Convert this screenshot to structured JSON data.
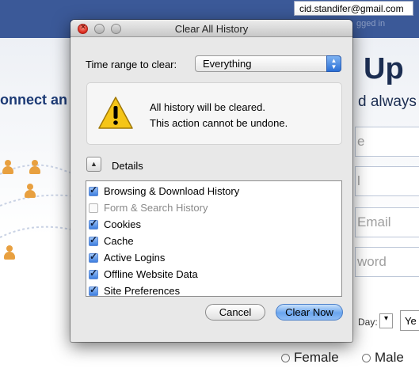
{
  "background": {
    "email_field": "cid.standifer@gmail.com",
    "logged_in_text": "gged in",
    "connect_text": "onnect an",
    "signup_heading": "Up",
    "always_text": "d always",
    "reg_fields": [
      {
        "placeholder": "e"
      },
      {
        "placeholder": "l"
      },
      {
        "placeholder": "Email"
      },
      {
        "placeholder": "word"
      }
    ],
    "birthday_label": "Day:",
    "day_select": "▾",
    "year_select": "Ye",
    "gender_female": "Female",
    "gender_male": "Male"
  },
  "dialog": {
    "title": "Clear All History",
    "time_range_label": "Time range to clear:",
    "time_range_value": "Everything",
    "warning_line1": "All history will be cleared.",
    "warning_line2": "This action cannot be undone.",
    "details_label": "Details",
    "items": [
      {
        "label": "Browsing & Download History",
        "checked": true,
        "enabled": true
      },
      {
        "label": "Form & Search History",
        "checked": false,
        "enabled": false
      },
      {
        "label": "Cookies",
        "checked": true,
        "enabled": true
      },
      {
        "label": "Cache",
        "checked": true,
        "enabled": true
      },
      {
        "label": "Active Logins",
        "checked": true,
        "enabled": true
      },
      {
        "label": "Offline Website Data",
        "checked": true,
        "enabled": true
      },
      {
        "label": "Site Preferences",
        "checked": true,
        "enabled": true
      }
    ],
    "cancel_label": "Cancel",
    "clear_label": "Clear Now"
  },
  "colors": {
    "facebook_blue": "#3b5998",
    "default_button": "#6aa5ee",
    "warning_yellow": "#f5c518"
  },
  "icons": {
    "warning": "warning-triangle-icon",
    "details_toggle": "disclosure-triangle-icon",
    "select_arrows": "updown-arrows-icon"
  }
}
